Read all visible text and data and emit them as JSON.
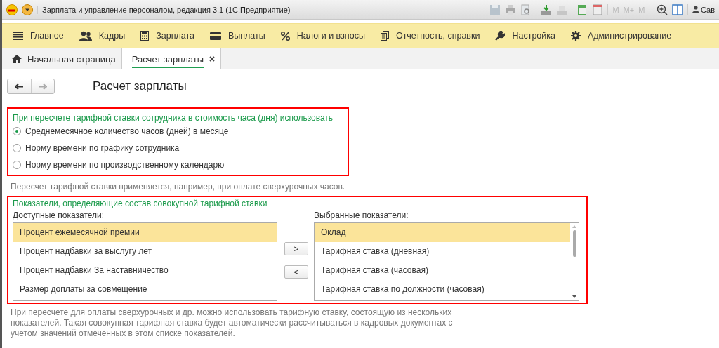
{
  "window": {
    "title": "Зарплата и управление персоналом, редакция 3.1  (1С:Предприятие)"
  },
  "toolbar": {
    "memory_buttons": [
      "M",
      "M+",
      "M-"
    ],
    "user": "Сав"
  },
  "sections": [
    {
      "label": "Главное"
    },
    {
      "label": "Кадры"
    },
    {
      "label": "Зарплата"
    },
    {
      "label": "Выплаты"
    },
    {
      "label": "Налоги и взносы"
    },
    {
      "label": "Отчетность, справки"
    },
    {
      "label": "Настройка"
    },
    {
      "label": "Администрирование"
    }
  ],
  "tabs": [
    {
      "label": "Начальная страница",
      "selected": false
    },
    {
      "label": "Расчет зарплаты",
      "selected": true
    }
  ],
  "form": {
    "title": "Расчет зарплаты",
    "rate_group": {
      "heading": "При пересчете тарифной ставки сотрудника в стоимость часа (дня) использовать",
      "options": [
        {
          "label": "Среднемесячное количество часов (дней) в месяце",
          "selected": true
        },
        {
          "label": "Норму времени по графику сотрудника",
          "selected": false
        },
        {
          "label": "Норму времени по производственному календарю",
          "selected": false
        }
      ]
    },
    "rate_note": "Пересчет тарифной ставки применяется, например, при оплате сверхурочных часов.",
    "indicators": {
      "heading": "Показатели, определяющие состав совокупной тарифной ставки",
      "available_label": "Доступные показатели:",
      "available": [
        {
          "label": "Процент ежемесячной премии",
          "selected": true
        },
        {
          "label": "Процент надбавки за выслугу лет",
          "selected": false
        },
        {
          "label": "Процент надбавки За наставничество",
          "selected": false
        },
        {
          "label": "Размер доплаты за совмещение",
          "selected": false
        }
      ],
      "move_buttons": [
        ">",
        "<"
      ],
      "chosen_label": "Выбранные показатели:",
      "chosen": [
        {
          "label": "Оклад",
          "selected": true
        },
        {
          "label": "Тарифная ставка (дневная)",
          "selected": false
        },
        {
          "label": "Тарифная ставка (часовая)",
          "selected": false
        },
        {
          "label": "Тарифная ставка по должности (часовая)",
          "selected": false
        }
      ]
    },
    "indicators_note": "При пересчете для оплаты сверхурочных и др. можно использовать тарифную ставку, состоящую из нескольких показателей. Такая совокупная тарифная ставка будет автоматически рассчитываться в кадровых документах с учетом значений отмеченных в этом списке показателей."
  }
}
